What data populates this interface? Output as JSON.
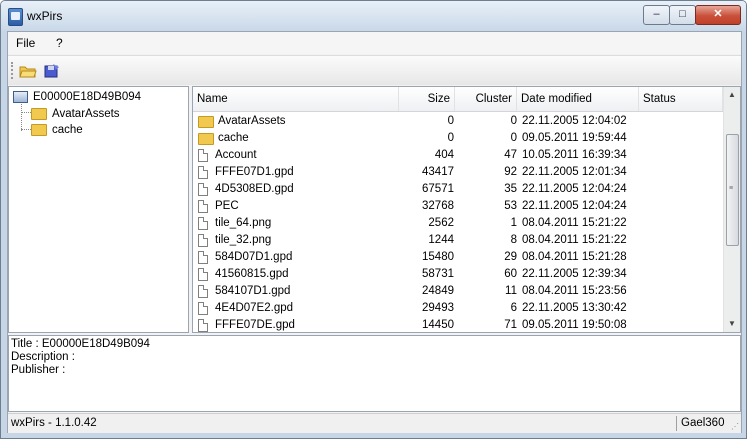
{
  "window": {
    "title": "wxPirs",
    "controls": {
      "minimize": "–",
      "maximize": "□",
      "close": "✕"
    }
  },
  "menu": {
    "items": [
      "File",
      "?"
    ]
  },
  "toolbar": {
    "open_icon": "open-folder-icon",
    "extract_icon": "extract-icon"
  },
  "tree": {
    "root": "E00000E18D49B094",
    "children": [
      "AvatarAssets",
      "cache"
    ]
  },
  "list": {
    "columns": [
      "Name",
      "Size",
      "Cluster",
      "Date modified",
      "Status"
    ],
    "rows": [
      {
        "type": "folder",
        "name": "AvatarAssets",
        "size": "0",
        "cluster": "0",
        "date": "22.11.2005 12:04:02",
        "status": ""
      },
      {
        "type": "folder",
        "name": "cache",
        "size": "0",
        "cluster": "0",
        "date": "09.05.2011 19:59:44",
        "status": ""
      },
      {
        "type": "file",
        "name": "Account",
        "size": "404",
        "cluster": "47",
        "date": "10.05.2011 16:39:34",
        "status": ""
      },
      {
        "type": "file",
        "name": "FFFE07D1.gpd",
        "size": "43417",
        "cluster": "92",
        "date": "22.11.2005 12:01:34",
        "status": ""
      },
      {
        "type": "file",
        "name": "4D5308ED.gpd",
        "size": "67571",
        "cluster": "35",
        "date": "22.11.2005 12:04:24",
        "status": ""
      },
      {
        "type": "file",
        "name": "PEC",
        "size": "32768",
        "cluster": "53",
        "date": "22.11.2005 12:04:24",
        "status": ""
      },
      {
        "type": "file",
        "name": "tile_64.png",
        "size": "2562",
        "cluster": "1",
        "date": "08.04.2011 15:21:22",
        "status": ""
      },
      {
        "type": "file",
        "name": "tile_32.png",
        "size": "1244",
        "cluster": "8",
        "date": "08.04.2011 15:21:22",
        "status": ""
      },
      {
        "type": "file",
        "name": "584D07D1.gpd",
        "size": "15480",
        "cluster": "29",
        "date": "08.04.2011 15:21:28",
        "status": ""
      },
      {
        "type": "file",
        "name": "41560815.gpd",
        "size": "58731",
        "cluster": "60",
        "date": "22.11.2005 12:39:34",
        "status": ""
      },
      {
        "type": "file",
        "name": "584107D1.gpd",
        "size": "24849",
        "cluster": "11",
        "date": "08.04.2011 15:23:56",
        "status": ""
      },
      {
        "type": "file",
        "name": "4E4D07E2.gpd",
        "size": "29493",
        "cluster": "6",
        "date": "22.11.2005 13:30:42",
        "status": ""
      },
      {
        "type": "file",
        "name": "FFFE07DE.gpd",
        "size": "14450",
        "cluster": "71",
        "date": "09.05.2011 19:50:08",
        "status": ""
      }
    ]
  },
  "info": {
    "title_line": "Title : E00000E18D49B094",
    "description_line": "Description :",
    "publisher_line": "Publisher :"
  },
  "status": {
    "left": "wxPirs - 1.1.0.42",
    "right": "Gael360"
  }
}
